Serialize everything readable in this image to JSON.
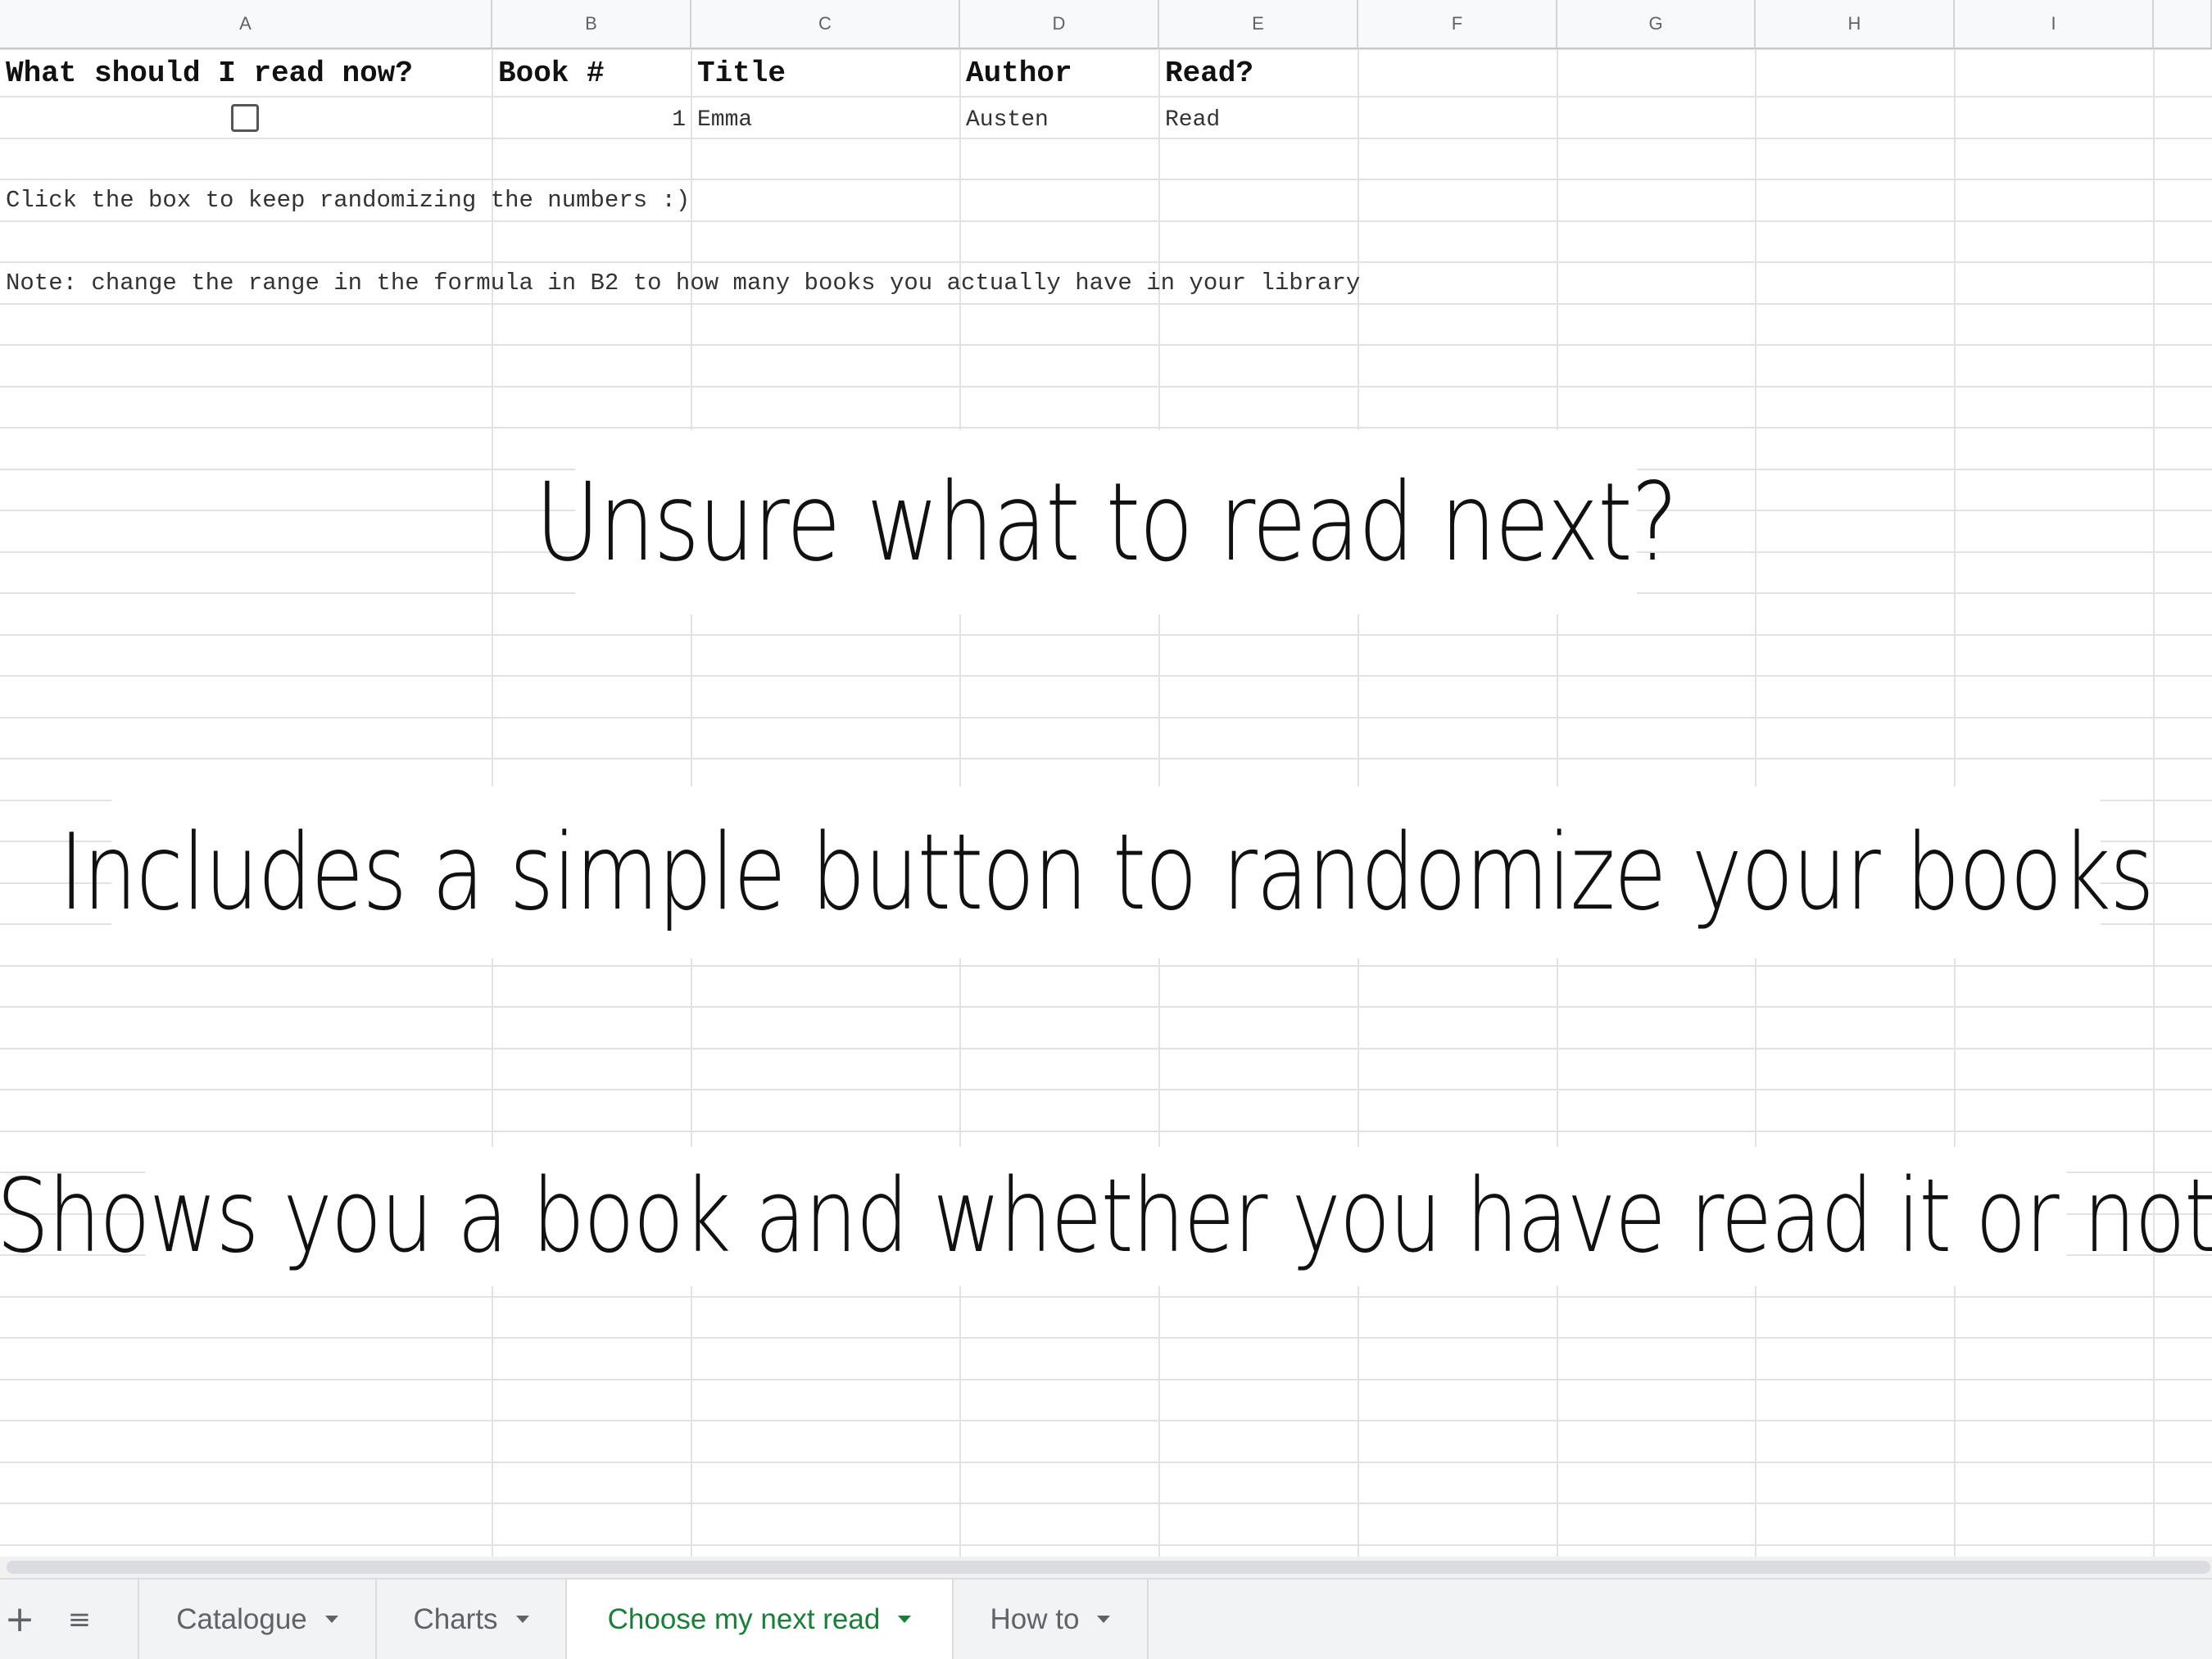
{
  "columns": [
    "A",
    "B",
    "C",
    "D",
    "E",
    "F",
    "G",
    "H",
    "I"
  ],
  "headers": {
    "a": "What should I read now?",
    "b": "Book #",
    "c": "Title",
    "d": "Author",
    "e": "Read?"
  },
  "row2": {
    "checked": false,
    "book_number": "1",
    "title": "Emma",
    "author": "Austen",
    "read": "Read"
  },
  "notes": {
    "click": "Click the box to keep randomizing the numbers :)",
    "range": "Note: change the range in the formula in B2 to how many books you actually have in your library"
  },
  "banners": {
    "line1": "Unsure what to read next?",
    "line2": "Includes a simple button to randomize your books",
    "line3": "Shows you a book and whether you have read it or not"
  },
  "sheet_tabs": [
    {
      "label": "Catalogue",
      "active": false
    },
    {
      "label": "Charts",
      "active": false
    },
    {
      "label": "Choose my next read",
      "active": true
    },
    {
      "label": "How to",
      "active": false
    }
  ],
  "icons": {
    "add_sheet": "plus-icon",
    "all_sheets": "list-icon"
  },
  "colors": {
    "active_tab_text": "#188038",
    "grid_line": "#e2e2e2",
    "header_bg": "#f8f9fa"
  }
}
